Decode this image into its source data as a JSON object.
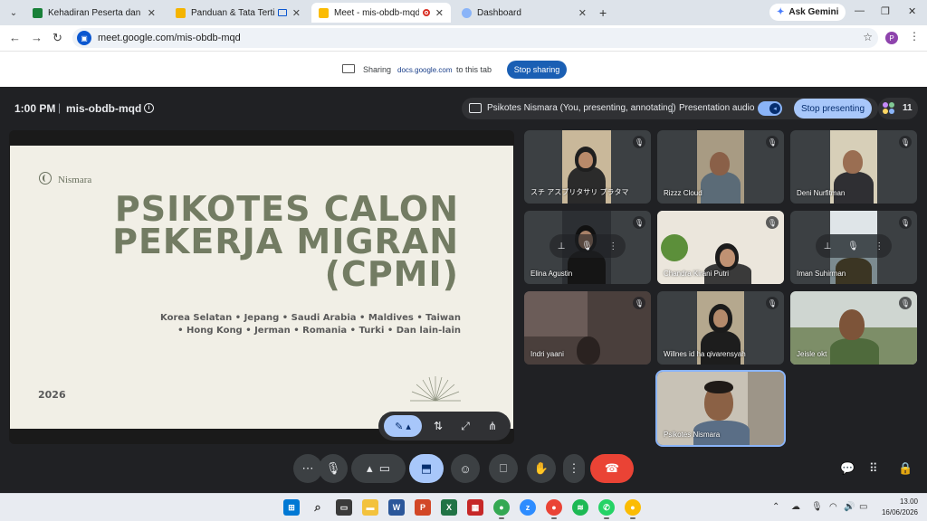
{
  "browser": {
    "tabs": [
      {
        "label": "Kehadiran Peserta dan Observas",
        "favicon_color": "#188038",
        "active": false
      },
      {
        "label": "Panduan & Tata Tertib Psik",
        "favicon_color": "#f4b400",
        "active": false
      },
      {
        "label": "Meet - mis-obdb-mqd",
        "favicon_color": "#fbbc04",
        "active": true
      },
      {
        "label": "Dashboard",
        "favicon_color": "#8ab4f8",
        "active": false
      }
    ],
    "ask_gemini": "Ask Gemini",
    "url": "meet.google.com/mis-obdb-mqd",
    "profile_initial": "P"
  },
  "sharebar": {
    "sharing": "Sharing",
    "domain": "docs.google.com",
    "to_tab": "to this tab",
    "stop_sharing": "Stop sharing"
  },
  "meet": {
    "time": "1:00 PM",
    "separator": "|",
    "meeting_code": "mis-obdb-mqd",
    "presenter_status": "Psikotes Nismara (You, presenting, annotating)",
    "presentation_audio": "Presentation audio",
    "stop_presenting": "Stop presenting",
    "participant_count": "11"
  },
  "slide": {
    "logo": "Nismara",
    "title_line1": "PSIKOTES CALON",
    "title_line2": "PEKERJA MIGRAN",
    "title_line3": "(CPMI)",
    "countries_line1": "Korea Selatan • Jepang • Saudi Arabia • Maldives • Taiwan",
    "countries_line2": "• Hong Kong • Jerman • Romania • Turki • Dan lain-lain",
    "year": "2026"
  },
  "participants": [
    {
      "name": "スチ アスプリタサリ プラタマ",
      "muted": true
    },
    {
      "name": "Rizzz Cloud",
      "muted": true
    },
    {
      "name": "Deni Nurfitman",
      "muted": true
    },
    {
      "name": "Elina Agustin",
      "muted": true
    },
    {
      "name": "Chandra Kirani Putri",
      "muted": true
    },
    {
      "name": "Iman Suhirman",
      "muted": true
    },
    {
      "name": "Indri yaani",
      "muted": true
    },
    {
      "name": "Willnes id ha qivarensyah",
      "muted": true
    },
    {
      "name": "Jeisle okt",
      "muted": true
    },
    {
      "name": "Psikotes Nismara",
      "muted": false
    }
  ],
  "taskbar": {
    "time": "13.00",
    "date": "16/06/2026"
  },
  "colors": {
    "meet_bg": "#202124",
    "accent_blue": "#a8c7fa",
    "end_call_red": "#ea4335",
    "slide_bg": "#f1efe6",
    "slide_title": "#737c63"
  }
}
